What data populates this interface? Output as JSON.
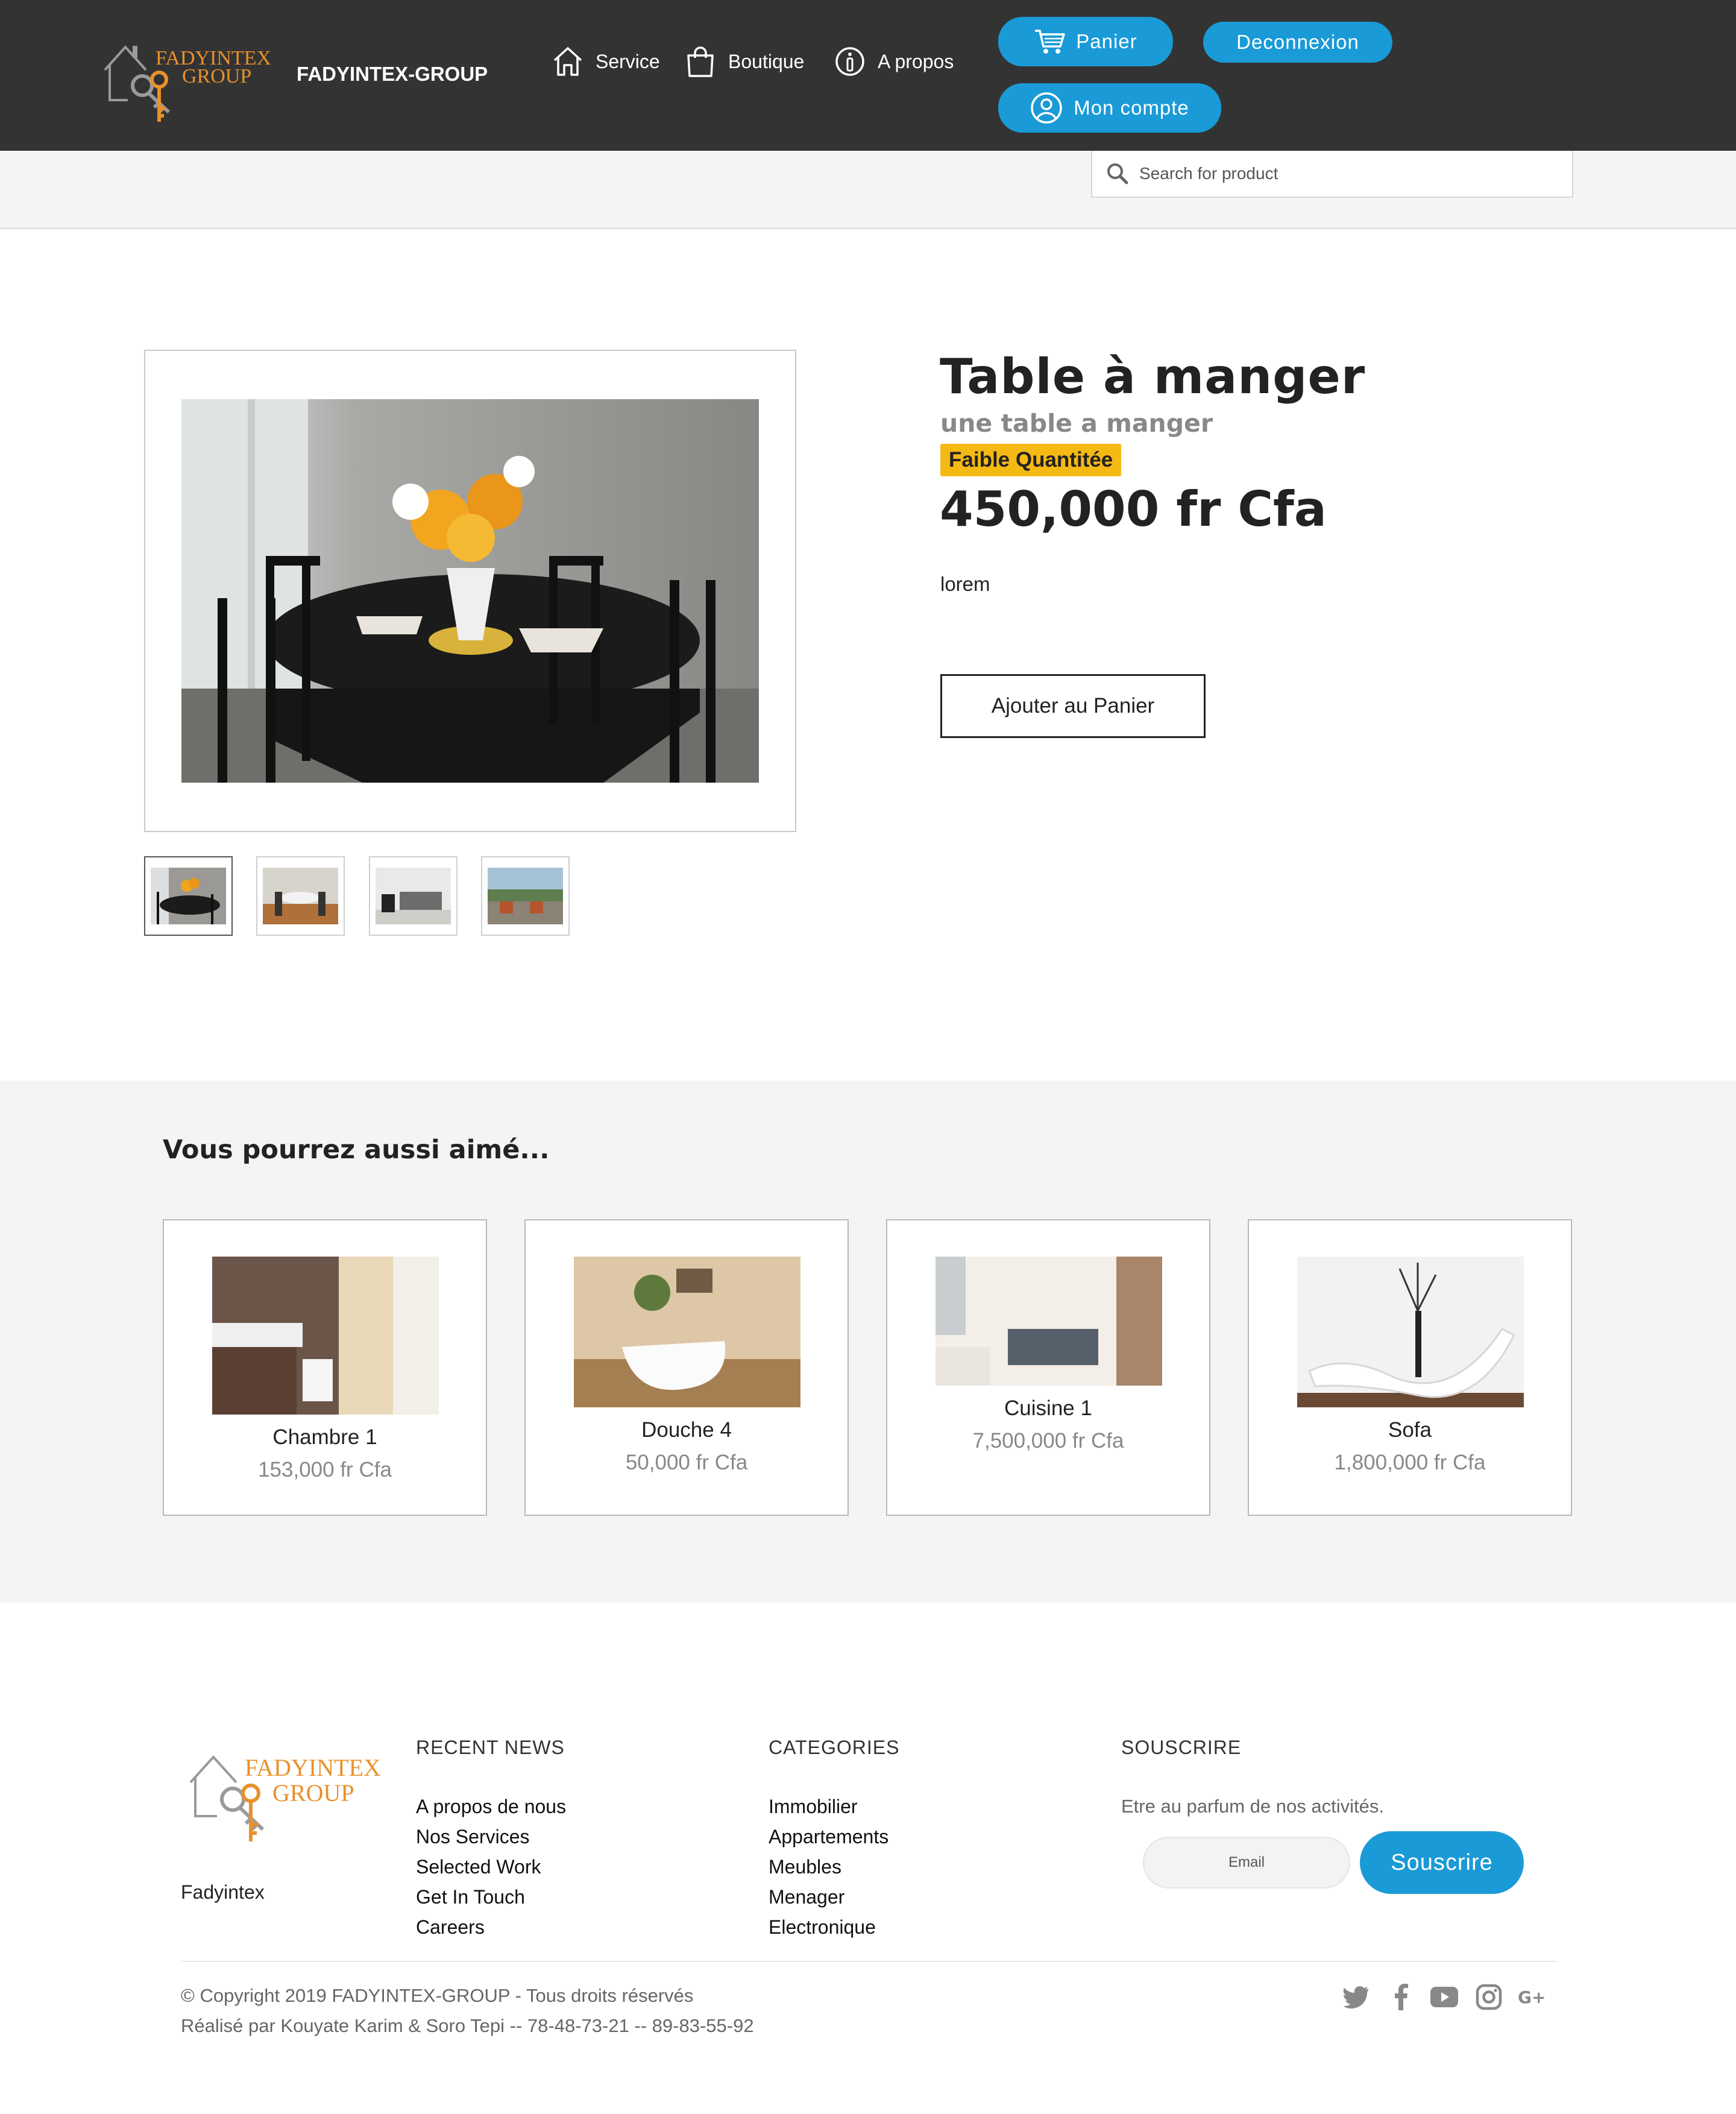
{
  "header": {
    "logo_line1": "FADYINTEX",
    "logo_line2": "GROUP",
    "brand": "FADYINTEX-GROUP",
    "nav": [
      {
        "label": "Service",
        "icon": "home-icon"
      },
      {
        "label": "Boutique",
        "icon": "shopping-bag-icon"
      },
      {
        "label": "A propos",
        "icon": "info-icon"
      }
    ],
    "cart_label": "Panier",
    "logout_label": "Deconnexion",
    "account_label": "Mon compte"
  },
  "search": {
    "placeholder": "Search for product"
  },
  "product": {
    "title": "Table à manger",
    "subtitle": "une table a manger",
    "badge": "Faible Quantitée",
    "price": "450,000 fr Cfa",
    "description": "lorem",
    "add_to_cart": "Ajouter au Panier",
    "thumbnail_count": 4
  },
  "related": {
    "heading": "Vous pourrez aussi aimé...",
    "items": [
      {
        "name": "Chambre 1",
        "price": "153,000 fr Cfa"
      },
      {
        "name": "Douche 4",
        "price": "50,000 fr Cfa"
      },
      {
        "name": "Cuisine 1",
        "price": "7,500,000 fr Cfa"
      },
      {
        "name": "Sofa",
        "price": "1,800,000 fr Cfa"
      }
    ]
  },
  "footer": {
    "brand": "Fadyintex",
    "logo_line1": "FADYINTEX",
    "logo_line2": "GROUP",
    "recent_news": {
      "heading": "RECENT NEWS",
      "links": [
        "A propos de nous",
        "Nos Services",
        "Selected Work",
        "Get In Touch",
        "Careers"
      ]
    },
    "categories": {
      "heading": "CATEGORIES",
      "links": [
        "Immobilier",
        "Appartements",
        "Meubles",
        "Menager",
        "Electronique"
      ]
    },
    "subscribe": {
      "heading": "SOUSCRIRE",
      "text": "Etre au parfum de nos activités.",
      "placeholder": "Email",
      "button": "Souscrire"
    },
    "copyright": "© Copyright 2019 FADYINTEX-GROUP - Tous droits réservés",
    "credits": "Réalisé par Kouyate Karim & Soro Tepi -- 78-48-73-21 -- 89-83-55-92",
    "social": [
      "twitter-icon",
      "facebook-icon",
      "youtube-icon",
      "instagram-icon",
      "google-plus-icon"
    ]
  },
  "colors": {
    "header_bg": "#333333",
    "accent": "#1a9ad6",
    "badge": "#f5b914",
    "logo_orange": "#e8912a",
    "section_bg": "#f4f4f4"
  }
}
